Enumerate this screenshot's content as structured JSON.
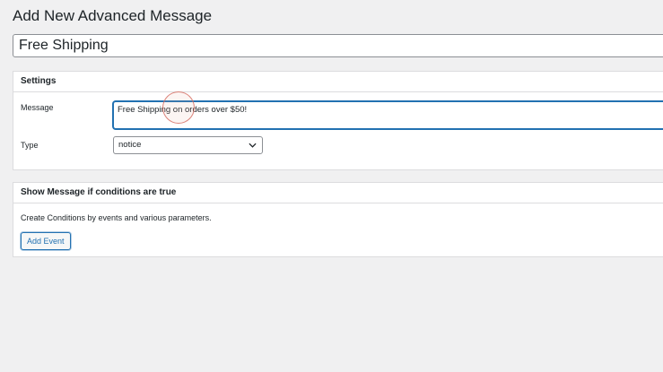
{
  "page": {
    "title": "Add New Advanced Message"
  },
  "post_title": {
    "value": "Free Shipping"
  },
  "settings_box": {
    "heading": "Settings",
    "message_label": "Message",
    "message_value": "Free Shipping on orders over $50!",
    "type_label": "Type",
    "type_selected": "notice"
  },
  "conditions_box": {
    "heading": "Show Message if conditions are true",
    "description": "Create Conditions by events and various parameters.",
    "add_event_label": "Add Event"
  },
  "colors": {
    "accent": "#2271b1",
    "background": "#f0f0f1",
    "click_indicator": "#d66e64"
  }
}
